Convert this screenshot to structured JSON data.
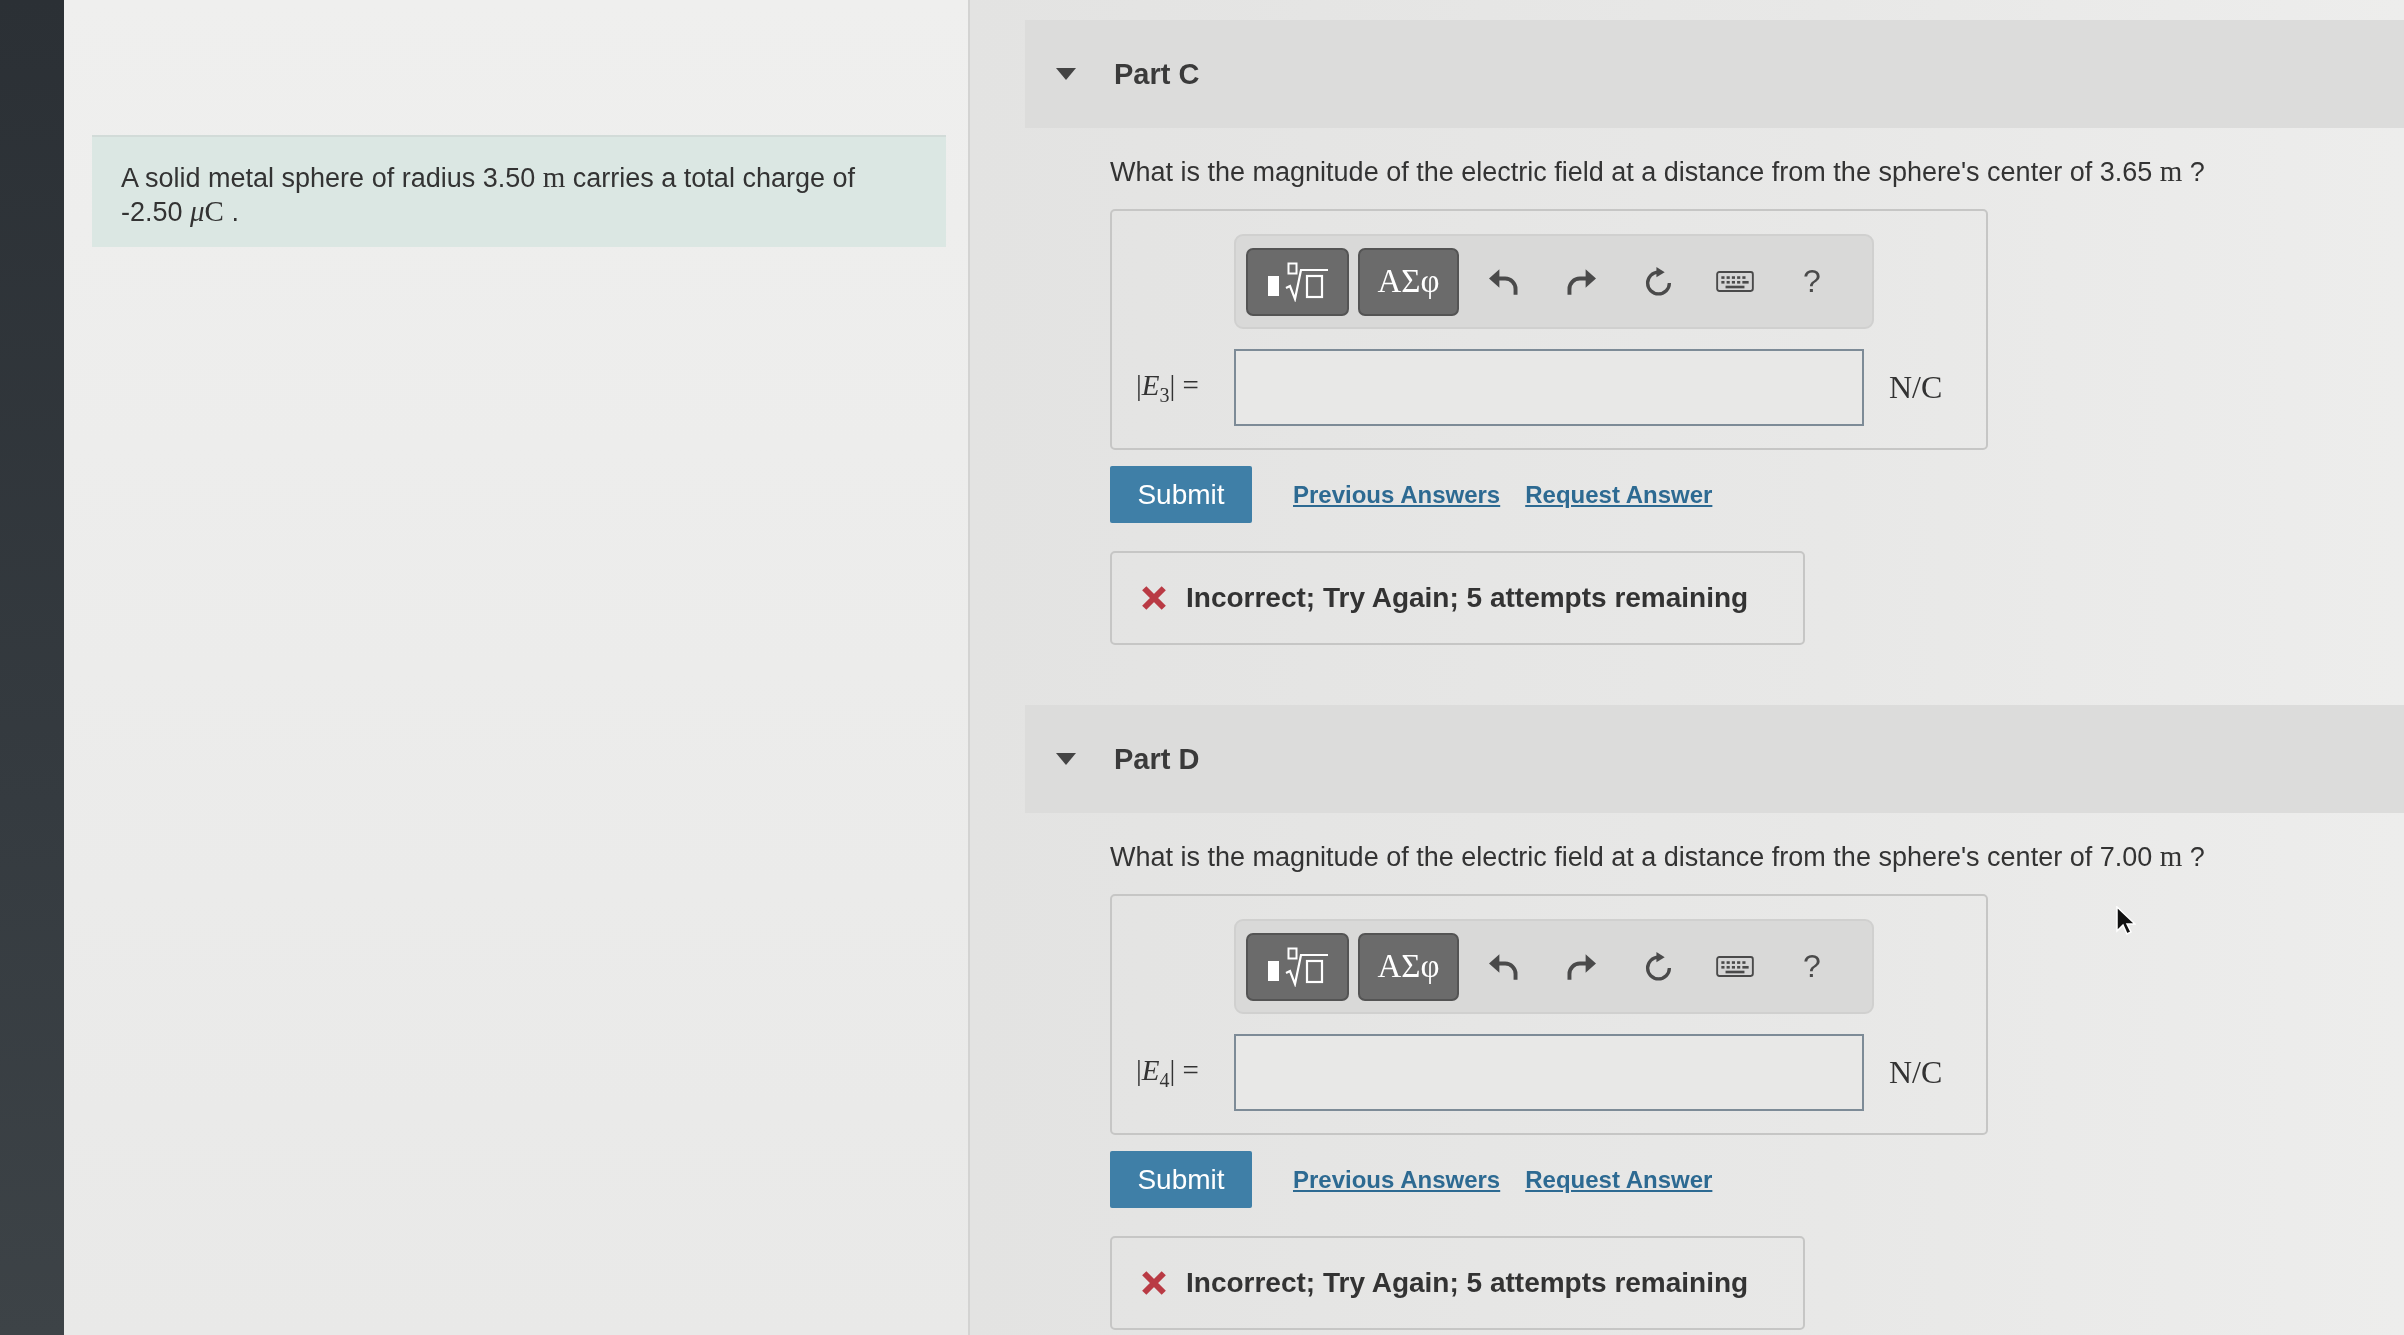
{
  "problem": {
    "segments": [
      {
        "kind": "text",
        "text": "A solid metal sphere of radius 3.50 "
      },
      {
        "kind": "math",
        "text": "m"
      },
      {
        "kind": "text",
        "text": " carries a total charge of -2.50 "
      },
      {
        "kind": "math-italic",
        "text": "μ"
      },
      {
        "kind": "math",
        "text": "C"
      },
      {
        "kind": "text",
        "text": " ."
      }
    ]
  },
  "parts": [
    {
      "title": "Part C",
      "expanded": true,
      "question": {
        "segments": [
          {
            "kind": "text",
            "text": "What is the magnitude of the electric field at a distance from the sphere's center of 3.65 "
          },
          {
            "kind": "math",
            "text": "m"
          },
          {
            "kind": "text",
            "text": " ?"
          }
        ]
      },
      "toolbar": {
        "symbols": "ΑΣφ",
        "help": "?"
      },
      "answer": {
        "label": "|*E*$_{3}$| =",
        "unit": "N/C"
      },
      "submit": "Submit",
      "links": [
        "Previous Answers",
        "Request Answer"
      ],
      "feedback": {
        "kind": "incorrect",
        "text": "Incorrect; Try Again; 5 attempts remaining"
      }
    },
    {
      "title": "Part D",
      "expanded": true,
      "question": {
        "segments": [
          {
            "kind": "text",
            "text": "What is the magnitude of the electric field at a distance from the sphere's center of 7.00 "
          },
          {
            "kind": "math",
            "text": "m"
          },
          {
            "kind": "text",
            "text": " ?"
          }
        ]
      },
      "toolbar": {
        "symbols": "ΑΣφ",
        "help": "?"
      },
      "answer": {
        "label": "|*E*$_{4}$| =",
        "unit": "N/C"
      },
      "submit": "Submit",
      "links": [
        "Previous Answers",
        "Request Answer"
      ],
      "feedback": {
        "kind": "incorrect",
        "text": "Incorrect; Try Again; 5 attempts remaining"
      }
    }
  ]
}
